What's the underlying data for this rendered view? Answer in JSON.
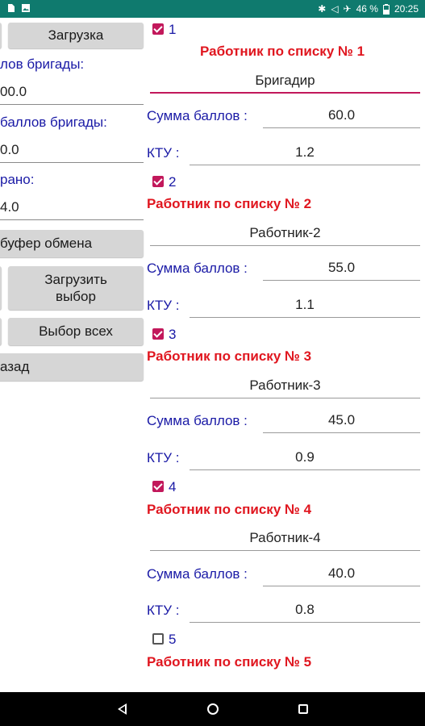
{
  "status_bar": {
    "battery": "46 %",
    "time": "20:25"
  },
  "left_panel": {
    "load_button": "Загрузка",
    "team_points_label": "лов бригады:",
    "team_points_value": "00.0",
    "team_points_sum_label": "баллов бригады:",
    "team_points_sum_value": "0.0",
    "collected_label": "рано:",
    "collected_value": "4.0",
    "clipboard_button": "буфер обмена",
    "load_selection_button": "Загрузить выбор",
    "select_all_button": "Выбор всех",
    "back_button": "азад"
  },
  "workers": [
    {
      "index": "1",
      "checked": true,
      "title": "Работник по списку № 1",
      "name": "Бригадир",
      "points_label": "Сумма баллов :",
      "points": "60.0",
      "ktu_label": "КТУ :",
      "ktu": "1.2"
    },
    {
      "index": "2",
      "checked": true,
      "title": "Работник по списку № 2",
      "name": "Работник-2",
      "points_label": "Сумма баллов :",
      "points": "55.0",
      "ktu_label": "КТУ :",
      "ktu": "1.1"
    },
    {
      "index": "3",
      "checked": true,
      "title": "Работник по списку № 3",
      "name": "Работник-3",
      "points_label": "Сумма баллов :",
      "points": "45.0",
      "ktu_label": "КТУ :",
      "ktu": "0.9"
    },
    {
      "index": "4",
      "checked": true,
      "title": "Работник по списку № 4",
      "name": "Работник-4",
      "points_label": "Сумма баллов :",
      "points": "40.0",
      "ktu_label": "КТУ :",
      "ktu": "0.8"
    },
    {
      "index": "5",
      "checked": false,
      "title": "Работник по списку № 5"
    }
  ],
  "colors": {
    "status_bar": "#0f7a6e",
    "accent": "#c2185b",
    "title_red": "#e0161f",
    "label_blue": "#1a1aa6",
    "button_gray": "#d6d6d6"
  }
}
